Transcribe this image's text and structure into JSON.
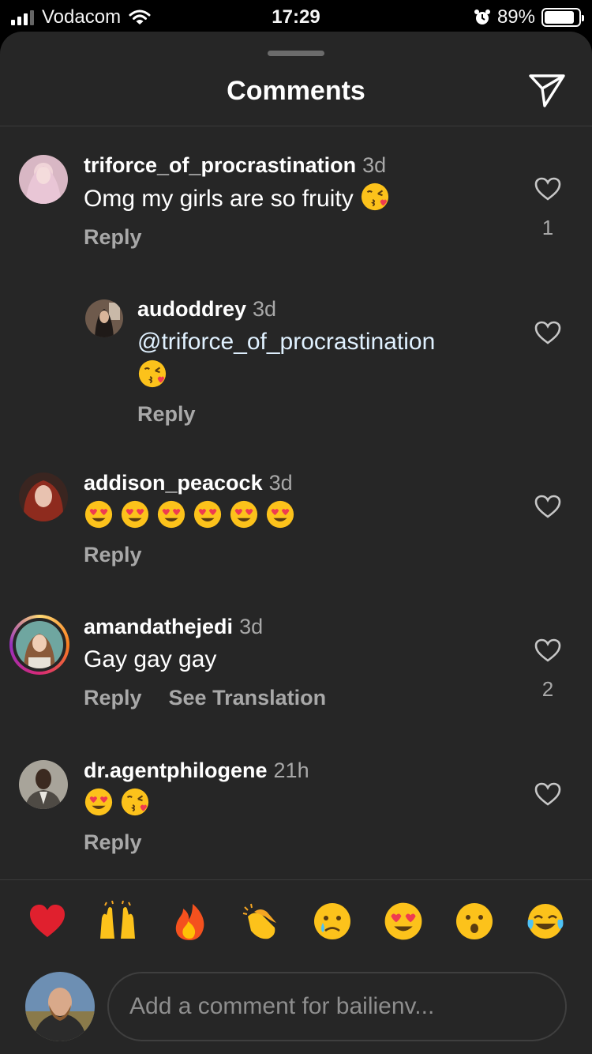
{
  "status_bar": {
    "carrier": "Vodacom",
    "time": "17:29",
    "battery_text": "89%",
    "battery_level": 0.89
  },
  "sheet": {
    "title": "Comments",
    "share_icon": "paper-plane-icon"
  },
  "comments": [
    {
      "username": "triforce_of_procrastination",
      "time": "3d",
      "text": "Omg my girls are so fruity",
      "emojis": [
        "face-blowing-kiss"
      ],
      "reply_label": "Reply",
      "likes": "1"
    },
    {
      "username": "audoddrey",
      "time": "3d",
      "mention": "@triforce_of_procrastination",
      "emojis": [
        "face-blowing-kiss"
      ],
      "reply_label": "Reply"
    },
    {
      "username": "addison_peacock",
      "time": "3d",
      "emojis": [
        "heart-eyes",
        "heart-eyes",
        "heart-eyes",
        "heart-eyes",
        "heart-eyes",
        "heart-eyes"
      ],
      "reply_label": "Reply"
    },
    {
      "username": "amandathejedi",
      "time": "3d",
      "text": "Gay gay gay",
      "reply_label": "Reply",
      "translate_label": "See Translation",
      "likes": "2"
    },
    {
      "username": "dr.agentphilogene",
      "time": "21h",
      "emojis": [
        "heart-eyes",
        "face-blowing-kiss"
      ],
      "reply_label": "Reply"
    }
  ],
  "quick_reactions": [
    "red-heart",
    "raising-hands",
    "fire",
    "clapping-hands",
    "crying-face",
    "heart-eyes",
    "astonished-face",
    "tears-of-joy"
  ],
  "composer": {
    "placeholder": "Add a comment for bailienv..."
  },
  "colors": {
    "sheet_bg": "#262626",
    "secondary_text": "#a8a8a8",
    "story_ring": [
      "#feda75",
      "#fa7e1e",
      "#d62976",
      "#962fbf"
    ]
  }
}
